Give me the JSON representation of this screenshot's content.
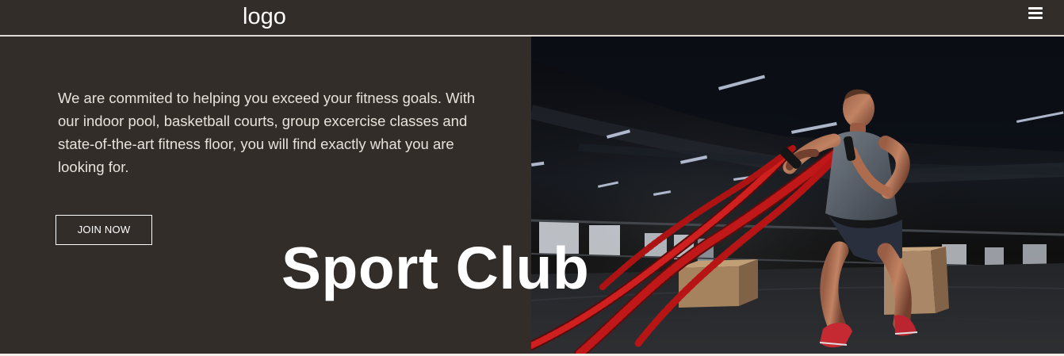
{
  "header": {
    "logo_text": "logo",
    "menu_icon": "hamburger-menu-icon"
  },
  "hero": {
    "description": "We are commited to helping you exceed your fitness goals. With our indoor pool, basketball courts, group excercise classes and state-of-the-art fitness floor, you will find exactly what you are looking for.",
    "join_button_label": "JOIN NOW",
    "title": "Sport Club",
    "image_subject": "athlete training with battle ropes in gym"
  },
  "colors": {
    "panel_background": "#332d29",
    "text": "#ffffff",
    "body_text": "#e8e2db",
    "rope_red": "#d51a1a",
    "page_background": "#f2efe8"
  }
}
